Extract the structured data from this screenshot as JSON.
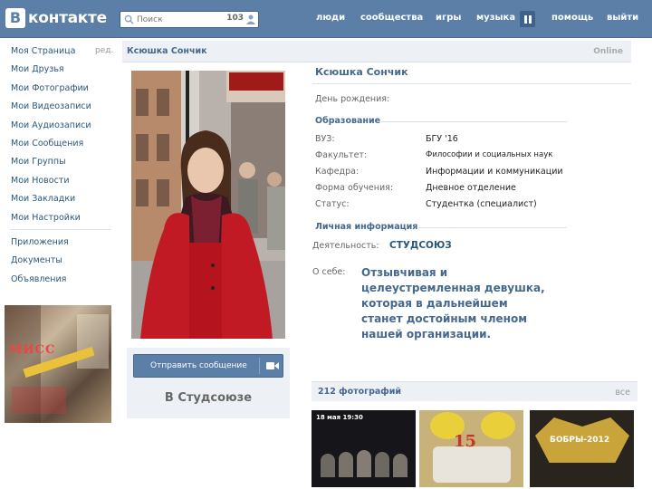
{
  "header": {
    "logo_letter": "В",
    "logo_text": "контакте",
    "search_placeholder": "Поиск",
    "search_count": "103",
    "nav": [
      "люди",
      "сообщества",
      "игры",
      "музыка",
      "помощь",
      "выйти"
    ]
  },
  "sidebar": {
    "edit_label": "ред.",
    "items": [
      "Моя Страница",
      "Мои Друзья",
      "Мои Фотографии",
      "Мои Видеозаписи",
      "Мои Аудиозаписи",
      "Мои Сообщения",
      "Мои Группы",
      "Мои Новости",
      "Мои Закладки",
      "Мои Настройки"
    ],
    "extra": [
      "Приложения",
      "Документы",
      "Объявления"
    ],
    "ad_title": "МИСС"
  },
  "profile": {
    "breadcrumb": "Ксюшка Сончик",
    "status": "Online",
    "name": "Ксюшка Сончик",
    "birthday_label": "День рождения:",
    "education_title": "Образование",
    "education": [
      {
        "label": "ВУЗ:",
        "value": "БГУ '16"
      },
      {
        "label": "Факультет:",
        "value": "Философии и социальных наук"
      },
      {
        "label": "Кафедра:",
        "value": "Информации и коммуникации"
      },
      {
        "label": "Форма обучения:",
        "value": "Дневное отделение"
      },
      {
        "label": "Статус:",
        "value": "Студентка (специалист)"
      }
    ],
    "personal_title": "Личная информация",
    "activity_label": "Деятельность:",
    "activity_value": "СТУДСОЮЗ",
    "about_label": "О себе:",
    "about_value": "Отзывчивая и целеустремленная девушка, которая в дальнейшем станет достойным членом нашей организации.",
    "send_button": "Отправить сообщение",
    "card_label": "В Студсоюзе",
    "photos_count": "212 фотографий",
    "photos_all": "все",
    "thumb1_text": "18 мая 19:30",
    "thumb2_text": "15",
    "thumb3_text": "БОБРЫ-2012"
  },
  "colors": {
    "header_bg": "#5b7fa6",
    "link": "#2b587a",
    "accent": "#45688e"
  }
}
